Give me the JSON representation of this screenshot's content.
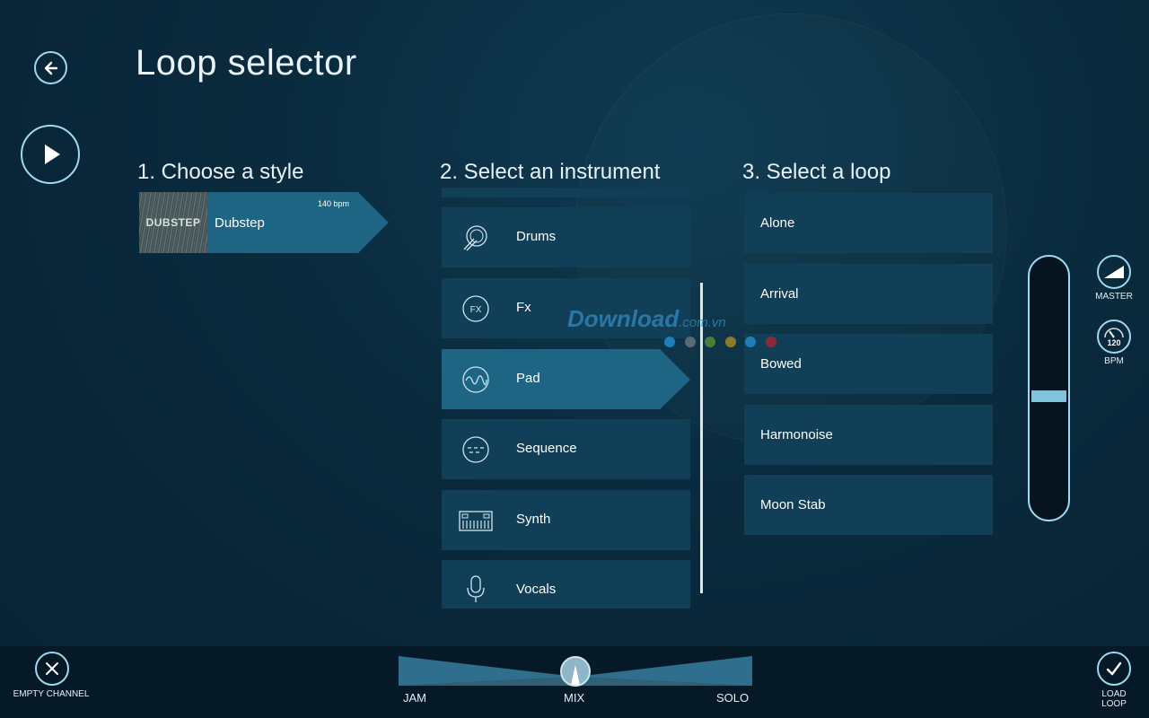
{
  "header": {
    "title": "Loop selector"
  },
  "columns": {
    "style": {
      "title": "1. Choose a style"
    },
    "instrument": {
      "title": "2. Select an instrument"
    },
    "loop": {
      "title": "3. Select a loop"
    }
  },
  "style_card": {
    "thumb_text": "DUBSTEP",
    "name": "Dubstep",
    "bpm": "140 bpm"
  },
  "instruments": [
    {
      "label": "Drums",
      "icon": "drums-icon"
    },
    {
      "label": "Fx",
      "icon": "fx-icon"
    },
    {
      "label": "Pad",
      "icon": "pad-icon",
      "selected": true
    },
    {
      "label": "Sequence",
      "icon": "sequence-icon"
    },
    {
      "label": "Synth",
      "icon": "synth-keyboard-icon"
    },
    {
      "label": "Vocals",
      "icon": "microphone-icon"
    }
  ],
  "loops": [
    "Alone",
    "Arrival",
    "Bowed",
    "Harmonoise",
    "Moon Stab"
  ],
  "side_controls": {
    "master_label": "MASTER",
    "bpm_label": "BPM",
    "bpm_value": "120",
    "volume_level": 0.5
  },
  "watermark": {
    "text": "Download",
    "suffix": ".com.vn"
  },
  "watermark_dots": [
    "#1e7fb8",
    "#5a6a72",
    "#4a7f3a",
    "#8a7a2a",
    "#1e7fb8",
    "#8a2a3a"
  ],
  "bottom": {
    "empty_channel": "EMPTY CHANNEL",
    "load_loop_line1": "LOAD",
    "load_loop_line2": "LOOP",
    "mix_labels": {
      "jam": "JAM",
      "mix": "MIX",
      "solo": "SOLO"
    },
    "mix_position": 0.5
  },
  "colors": {
    "accent": "#9fd8ef",
    "selected": "#1d6583",
    "tile": "#113f58"
  }
}
